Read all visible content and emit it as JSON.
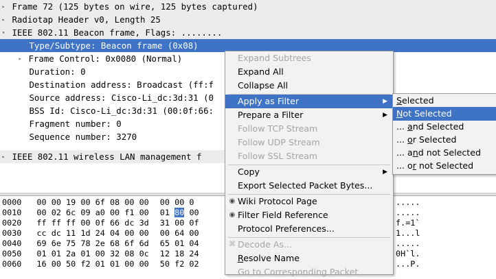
{
  "tree": {
    "rows": [
      {
        "text": "Frame 72 (125 bytes on wire, 125 bytes captured)",
        "arrow": "▸"
      },
      {
        "text": "Radiotap Header v0, Length 25",
        "arrow": "▸"
      },
      {
        "text": "IEEE 802.11 Beacon frame, Flags: ........",
        "arrow": "▾"
      },
      {
        "text": "Type/Subtype: Beacon frame (0x08)",
        "arrow": ""
      },
      {
        "text": "Frame Control: 0x0080 (Normal)",
        "arrow": "▸"
      },
      {
        "text": "Duration: 0",
        "arrow": ""
      },
      {
        "text": "Destination address: Broadcast (ff:f",
        "arrow": ""
      },
      {
        "text": "Source address: Cisco-Li_dc:3d:31 (0",
        "arrow": ""
      },
      {
        "text": "BSS Id: Cisco-Li_dc:3d:31 (00:0f:66:",
        "arrow": ""
      },
      {
        "text": "Fragment number: 0",
        "arrow": ""
      },
      {
        "text": "Sequence number: 3270",
        "arrow": ""
      },
      {
        "text": "IEEE 802.11 wireless LAN management f",
        "arrow": "▸"
      }
    ],
    "selected_row": "Type/Subtype: Beacon frame (0x08)"
  },
  "hex": {
    "rows": [
      {
        "offset": "0000",
        "bytes_a": "00 00 19 00 6f 08 00 00",
        "bytes_b": "00 00 0",
        "ascii": "....."
      },
      {
        "offset": "0010",
        "bytes_a": "00 02 6c 09 a0 00 f1 00",
        "bytes_b": "01",
        "hl": "80",
        "bytes_c": "00",
        "ascii": "....."
      },
      {
        "offset": "0020",
        "bytes_a": "ff ff ff 00 0f 66 dc 3d",
        "bytes_b": "31 00 0f",
        "ascii": "f.=1`"
      },
      {
        "offset": "0030",
        "bytes_a": "cc dc 11 1d 24 04 00 00",
        "bytes_b": "00 64 00",
        "ascii": "1...l"
      },
      {
        "offset": "0040",
        "bytes_a": "69 6e 75 78 2e 68 6f 6d",
        "bytes_b": "65 01 04",
        "ascii": "....."
      },
      {
        "offset": "0050",
        "bytes_a": "01 01 2a 01 00 32 08 0c",
        "bytes_b": "12 18 24",
        "ascii": "0H`l."
      },
      {
        "offset": "0060",
        "bytes_a": "16 00 50 f2 01 01 00 00",
        "bytes_b": "50 f2 02",
        "ascii": "...P."
      }
    ]
  },
  "context_menu": {
    "expand_subtrees": "Expand Subtrees",
    "expand_all": "Expand All",
    "collapse_all": "Collapse All",
    "apply_as_filter": "Apply as Filter",
    "prepare_a_filter": "Prepare a Filter",
    "follow_tcp": "Follow TCP Stream",
    "follow_udp": "Follow UDP Stream",
    "follow_ssl": "Follow SSL Stream",
    "copy": "Copy",
    "export_selected": "Export Selected Packet Bytes...",
    "wiki_protocol_page": "Wiki Protocol Page",
    "filter_field_reference": "Filter Field Reference",
    "protocol_preferences": "Protocol Preferences...",
    "decode_as": "Decode As...",
    "resolve_name_pre": "R",
    "resolve_name_post": "esolve Name",
    "go_to_packet": "Go to Corresponding Packet"
  },
  "submenu": {
    "selected_pre": "S",
    "selected_post": "elected",
    "not_selected_pre": "N",
    "not_selected_post": "ot Selected",
    "and_selected_pre": "... ",
    "and_selected_u": "a",
    "and_selected_post": "nd Selected",
    "or_selected_pre": "... ",
    "or_selected_u": "o",
    "or_selected_post": "r Selected",
    "and_not_selected_pre": "... a",
    "and_not_selected_u": "n",
    "and_not_selected_post": "d not Selected",
    "or_not_selected_pre": "... o",
    "or_not_selected_u": "r",
    "or_not_selected_post": " not Selected"
  },
  "colors": {
    "selection": "#3f73c6",
    "menu_bg": "#f2f2f2",
    "disabled_text": "#a5a5a5"
  }
}
